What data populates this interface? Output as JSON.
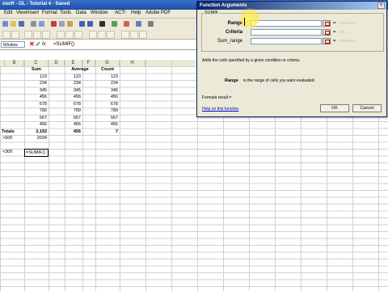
{
  "window": {
    "title": "osoft - OL - Tutorial 4 - Saved"
  },
  "menu": [
    "Edit",
    "View",
    "Insert",
    "Format",
    "Tools",
    "Data",
    "Window",
    "ACT!",
    "Help",
    "Adobe PDF"
  ],
  "formula_bar": {
    "name_box": "Window",
    "formula": "=SUMIF()"
  },
  "columns": [
    "B",
    "C",
    "D",
    "E",
    "F",
    "G",
    "H"
  ],
  "sheet": {
    "headers": {
      "sum": "Sum",
      "average": "Average",
      "count": "Count"
    },
    "rows": [
      {
        "sum": "123",
        "average": "123",
        "count": "123"
      },
      {
        "sum": "234",
        "average": "234",
        "count": "234"
      },
      {
        "sum": "345",
        "average": "345",
        "count": "345"
      },
      {
        "sum": "456",
        "average": "456",
        "count": "456"
      },
      {
        "sum": "678",
        "average": "678",
        "count": "678"
      },
      {
        "sum": "789",
        "average": "789",
        "count": "789"
      },
      {
        "sum": "567",
        "average": "567",
        "count": "567"
      },
      {
        "sum": "456",
        "average": "456",
        "count": "456"
      }
    ],
    "totals": {
      "label": "Totals",
      "sum": "3,192",
      "average": "456",
      "count": "7"
    },
    "criteria1": {
      "label": ">500",
      "value": "2034"
    },
    "criteria2": {
      "label": "<300",
      "value": "=SUMIF()"
    }
  },
  "dialog": {
    "title": "Function Arguments",
    "function_name": "SUMIF",
    "args": [
      {
        "label": "Range",
        "value": "",
        "hint": "reference"
      },
      {
        "label": "Criteria",
        "value": "",
        "hint": "any"
      },
      {
        "label": "Sum_range",
        "value": "",
        "hint": "reference"
      }
    ],
    "description": "Adds the cells specified by a given condition or criteria.",
    "arg_desc_label": "Range",
    "arg_desc": "is the range of cells you want evaluated.",
    "result_label": "Formula result =",
    "help_link": "Help on this function",
    "ok_label": "OK",
    "cancel_label": "Cancel",
    "close_label": "×"
  }
}
